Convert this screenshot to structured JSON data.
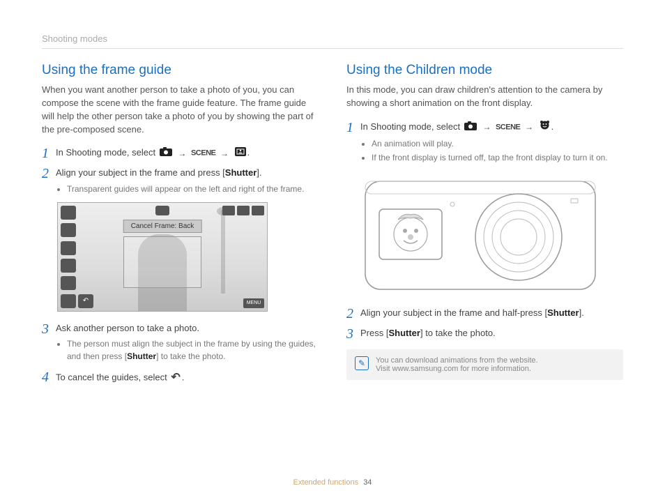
{
  "section": "Shooting modes",
  "footer": {
    "label": "Extended functions",
    "page": "34"
  },
  "left": {
    "title": "Using the frame guide",
    "intro": "When you want another person to take a photo of you, you can compose the scene with the frame guide feature. The frame guide will help the other person take a photo of you by showing the part of the pre-composed scene.",
    "step1_pre": "In Shooting mode, select ",
    "scene_label": "SCENE",
    "step2": "Align your subject in the frame and press [",
    "shutter": "Shutter",
    "step2_end": "].",
    "step2_bullet": "Transparent guides will appear on the left and right of the frame.",
    "lcd_cancel": "Cancel Frame: Back",
    "lcd_menu": "MENU",
    "step3": "Ask another person to take a photo.",
    "step3_bullet_a": "The person must align the subject in the frame by using the guides, and then press [",
    "step3_bullet_b": "] to take the photo.",
    "step4": "To cancel the guides, select "
  },
  "right": {
    "title": "Using the Children mode",
    "intro": "In this mode, you can draw children's attention to the camera by showing a short animation on the front display.",
    "step1_pre": "In Shooting mode, select ",
    "scene_label": "SCENE",
    "step1_b1": "An animation will play.",
    "step1_b2": "If the front display is turned off, tap the front display to turn it on.",
    "step2_a": "Align your subject in the frame and half-press [",
    "shutter": "Shutter",
    "step2_b": "].",
    "step3_a": "Press [",
    "step3_b": "] to take the photo.",
    "note1": "You can download animations from the website.",
    "note2": "Visit www.samsung.com for more information."
  }
}
